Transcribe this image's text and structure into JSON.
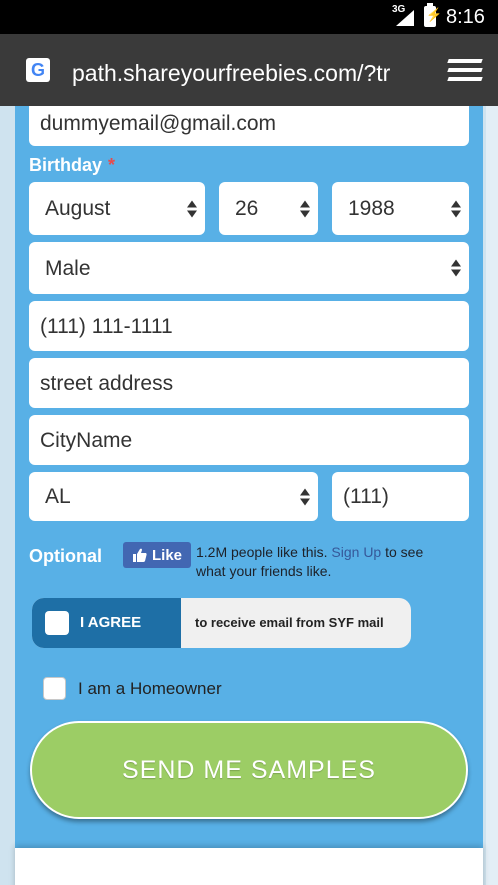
{
  "status_bar": {
    "network": "3G",
    "battery_glyph": "⚡",
    "time": "8:16"
  },
  "browser": {
    "url": "path.shareyourfreebies.com/?tr",
    "favicon": "G"
  },
  "form": {
    "email_value": "dummyemail@gmail.com",
    "birthday_label": "Birthday",
    "required_marker": "*",
    "birth_month": "August",
    "birth_day": "26",
    "birth_year": "1988",
    "gender": "Male",
    "phone": "(111) 111-1111",
    "street": "street address",
    "city": "CityName",
    "state": "AL",
    "zip": "(111)",
    "optional_label": "Optional",
    "like": {
      "button_label": "Like",
      "text_before": "1.2M people like this. ",
      "sign_up_link": "Sign Up",
      "text_after": " to see what your friends like."
    },
    "agree": {
      "label": "I AGREE",
      "text": "to receive email from SYF mail",
      "checked": false
    },
    "homeowner": {
      "label": "I am a Homeowner",
      "checked": false
    },
    "submit_label": "SEND ME SAMPLES"
  },
  "colors": {
    "panel": "#58b0e6",
    "agree_dark": "#1e6fa6",
    "submit": "#9ccd65",
    "required": "#e84b4b"
  }
}
